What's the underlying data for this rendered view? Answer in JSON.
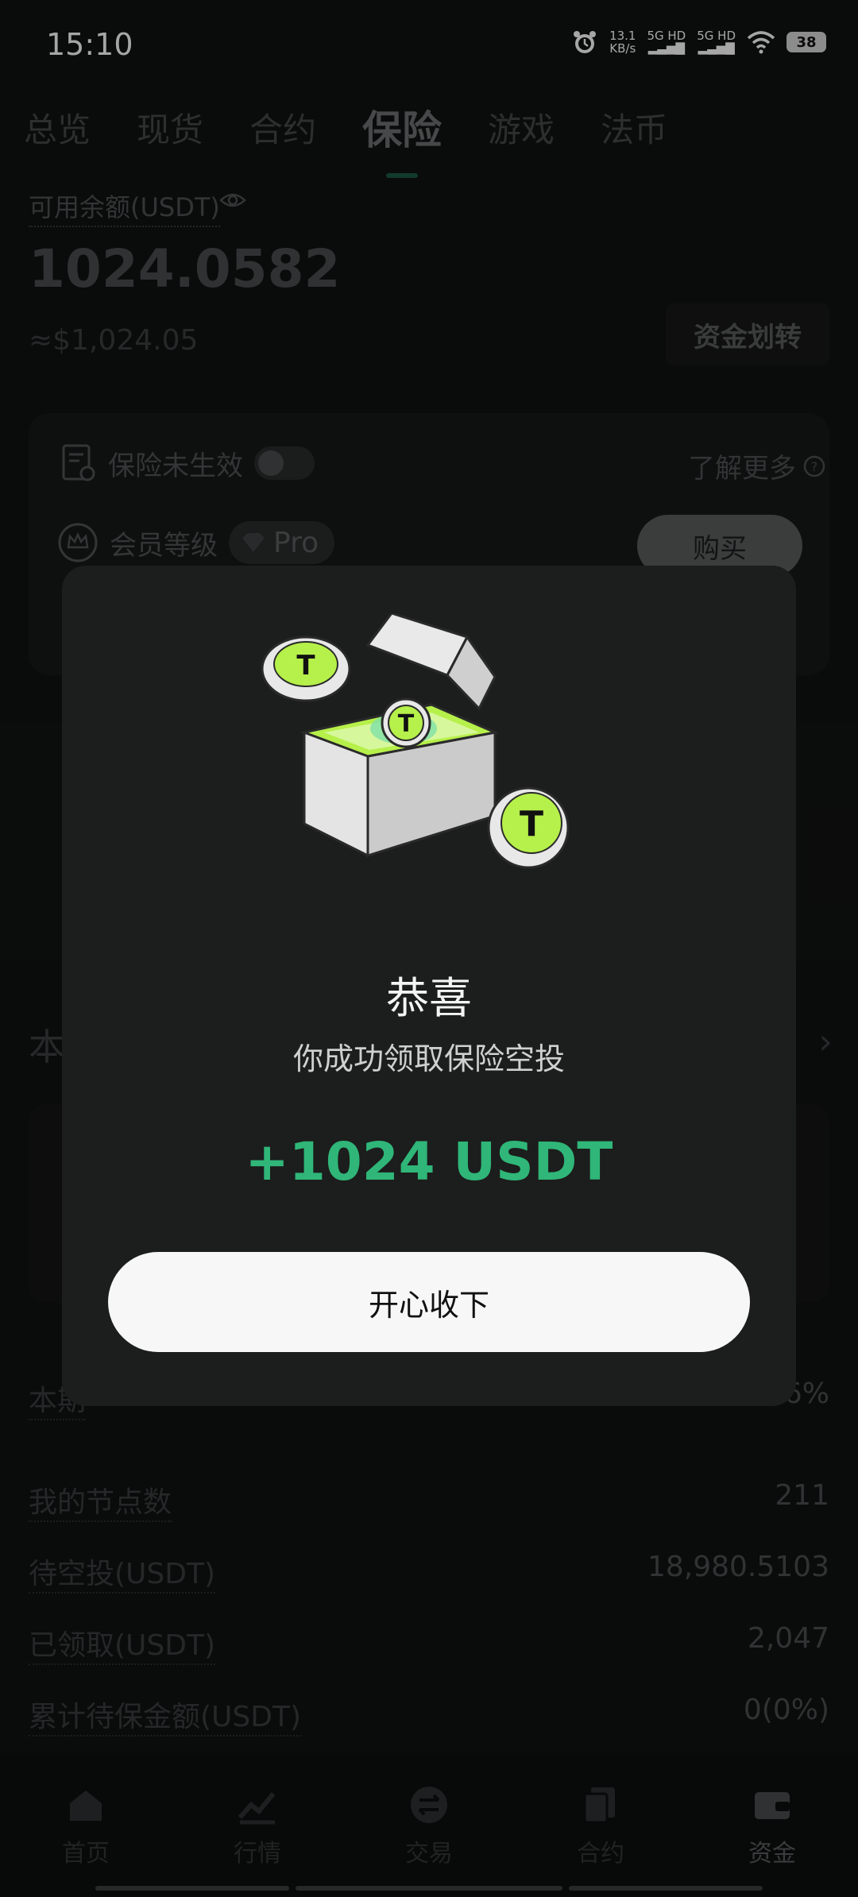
{
  "status_bar": {
    "time": "15:10",
    "net_speed_value": "13.1",
    "net_speed_unit": "KB/s",
    "sim1": "5G HD",
    "sim2": "5G HD",
    "battery": "38"
  },
  "tabs": [
    {
      "label": "总览"
    },
    {
      "label": "现货"
    },
    {
      "label": "合约"
    },
    {
      "label": "保险",
      "active": true
    },
    {
      "label": "游戏"
    },
    {
      "label": "法币"
    }
  ],
  "balance": {
    "label": "可用余额(USDT)",
    "value": "1024.0582",
    "usd": "≈$1,024.05",
    "transfer_button": "资金划转"
  },
  "insurance": {
    "status_label": "保险未生效",
    "learn_more": "了解更多",
    "member_level_label": "会员等级",
    "member_badge": "Pro",
    "buy_button": "购买"
  },
  "section": {
    "title_partial": "本"
  },
  "list": [
    {
      "key": "本期",
      "value": "6%"
    },
    {
      "key": "我的节点数",
      "value": "211"
    },
    {
      "key": "待空投(USDT)",
      "value": "18,980.5103"
    },
    {
      "key": "已领取(USDT)",
      "value": "2,047"
    },
    {
      "key": "累计待保金额(USDT)",
      "value": "0(0%)"
    }
  ],
  "bottom_nav": [
    {
      "label": "首页",
      "icon": "home-icon"
    },
    {
      "label": "行情",
      "icon": "chart-icon"
    },
    {
      "label": "交易",
      "icon": "trade-icon"
    },
    {
      "label": "合约",
      "icon": "contract-icon"
    },
    {
      "label": "资金",
      "icon": "wallet-icon",
      "active": true
    }
  ],
  "modal": {
    "title": "恭喜",
    "subtitle": "你成功领取保险空投",
    "amount": "+1024 USDT",
    "confirm_button": "开心收下"
  },
  "colors": {
    "accent_green": "#2fb678",
    "coin_green": "#b6f04a",
    "background": "#101111",
    "modal_bg": "#1c1d1d"
  }
}
